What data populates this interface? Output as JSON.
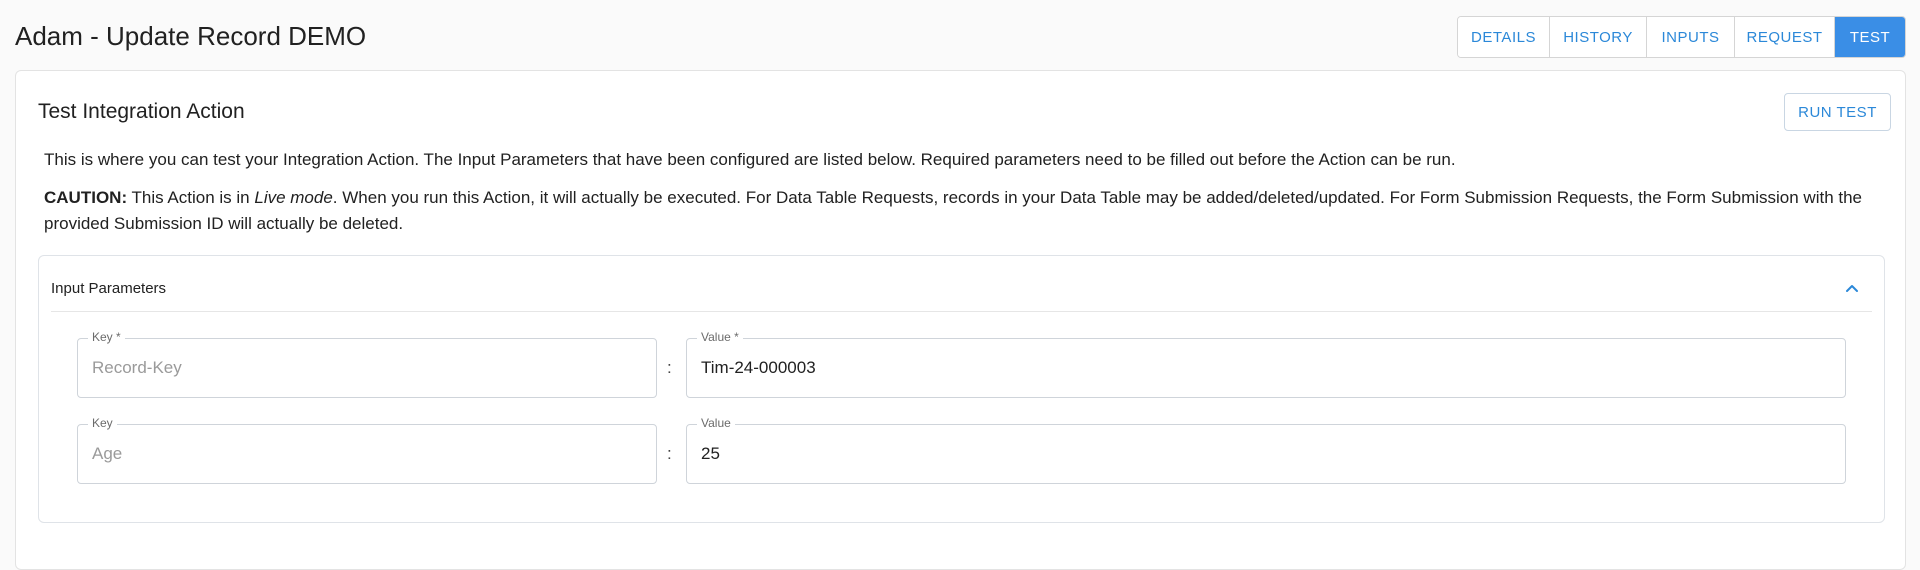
{
  "header": {
    "title": "Adam - Update Record DEMO",
    "tabs": [
      {
        "label": "DETAILS",
        "active": false
      },
      {
        "label": "HISTORY",
        "active": false
      },
      {
        "label": "INPUTS",
        "active": false
      },
      {
        "label": "REQUEST",
        "active": false
      },
      {
        "label": "TEST",
        "active": true
      }
    ]
  },
  "card": {
    "title": "Test Integration Action",
    "run_test_label": "RUN TEST",
    "intro": "This is where you can test your Integration Action. The Input Parameters that have been configured are listed below. Required parameters need to be filled out before the Action can be run.",
    "caution": {
      "label": "CAUTION:",
      "pre": " This Action is in ",
      "mode": "Live mode",
      "post": ". When you run this Action, it will actually be executed. For Data Table Requests, records in your Data Table may be added/deleted/updated. For Form Submission Requests, the Form Submission with the provided Submission ID will actually be deleted."
    }
  },
  "input_parameters": {
    "title": "Input Parameters",
    "collapse_icon": "chevron-up-icon",
    "separator": ":",
    "rows": [
      {
        "key_label": "Key *",
        "key_placeholder": "Record-Key",
        "value_label": "Value *",
        "value": "Tim-24-000003"
      },
      {
        "key_label": "Key",
        "key_placeholder": "Age",
        "value_label": "Value",
        "value": "25"
      }
    ]
  },
  "colors": {
    "accent": "#3a8ee6",
    "link": "#2b88d8"
  }
}
